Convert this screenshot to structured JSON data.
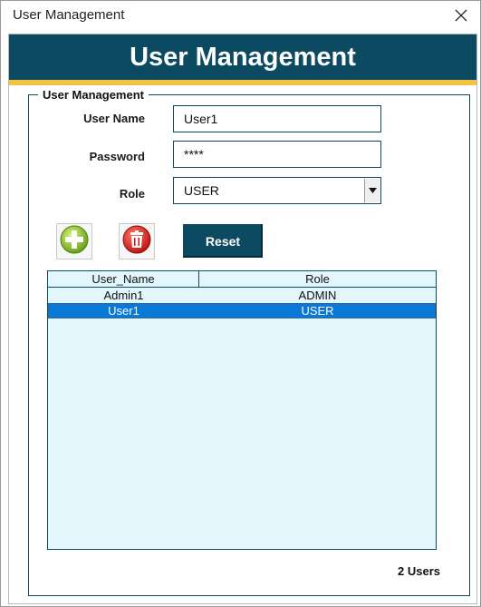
{
  "window": {
    "title": "User Management"
  },
  "banner": {
    "title": "User Management"
  },
  "group": {
    "legend": "User Management"
  },
  "fields": {
    "username": {
      "label": "User Name",
      "value": "User1"
    },
    "password": {
      "label": "Password",
      "value": "****"
    },
    "role": {
      "label": "Role",
      "value": "USER"
    }
  },
  "buttons": {
    "reset": "Reset"
  },
  "list": {
    "headers": [
      "User_Name",
      "Role"
    ],
    "rows": [
      {
        "user": "Admin1",
        "role": "ADMIN",
        "selected": false
      },
      {
        "user": "User1",
        "role": "USER",
        "selected": true
      }
    ]
  },
  "status": {
    "count": "2 Users"
  },
  "colors": {
    "banner": "#0b4a60",
    "stripe": "#f5c342",
    "listbg": "#e3f6fc",
    "selection": "#0a78d7"
  }
}
